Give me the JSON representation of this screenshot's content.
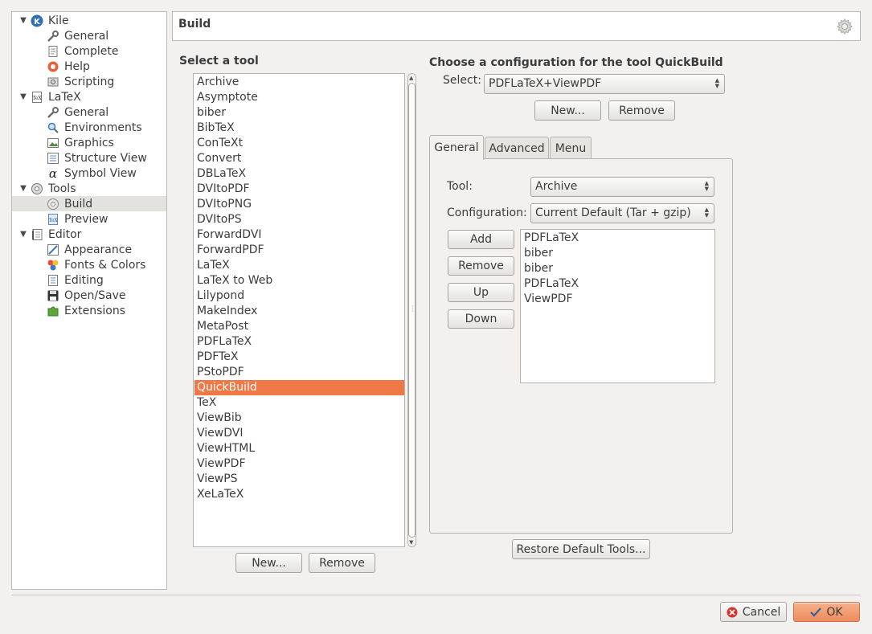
{
  "header": {
    "title": "Build"
  },
  "tree": [
    {
      "label": "Kile",
      "icon": "kile-icon",
      "level": 0,
      "expanded": true
    },
    {
      "label": "General",
      "icon": "wrench-icon",
      "level": 1
    },
    {
      "label": "Complete",
      "icon": "document-icon",
      "level": 1
    },
    {
      "label": "Help",
      "icon": "help-lifebuoy-icon",
      "level": 1
    },
    {
      "label": "Scripting",
      "icon": "scripting-gear-icon",
      "level": 1
    },
    {
      "label": "LaTeX",
      "icon": "tex-document-icon",
      "level": 0,
      "expanded": true
    },
    {
      "label": "General",
      "icon": "wrench-icon",
      "level": 1
    },
    {
      "label": "Environments",
      "icon": "magnifier-icon",
      "level": 1
    },
    {
      "label": "Graphics",
      "icon": "graphics-icon",
      "level": 1
    },
    {
      "label": "Structure View",
      "icon": "structure-view-icon",
      "level": 1
    },
    {
      "label": "Symbol View",
      "icon": "alpha-symbol-icon",
      "level": 1
    },
    {
      "label": "Tools",
      "icon": "tools-gear-icon",
      "level": 0,
      "expanded": true
    },
    {
      "label": "Build",
      "icon": "build-gear-icon",
      "level": 1,
      "selected": true
    },
    {
      "label": "Preview",
      "icon": "tex-preview-icon",
      "level": 1
    },
    {
      "label": "Editor",
      "icon": "editor-notebook-icon",
      "level": 0,
      "expanded": true
    },
    {
      "label": "Appearance",
      "icon": "appearance-icon",
      "level": 1
    },
    {
      "label": "Fonts & Colors",
      "icon": "fonts-colors-icon",
      "level": 1
    },
    {
      "label": "Editing",
      "icon": "editing-icon",
      "level": 1
    },
    {
      "label": "Open/Save",
      "icon": "floppy-disk-icon",
      "level": 1
    },
    {
      "label": "Extensions",
      "icon": "puzzle-piece-icon",
      "level": 1
    }
  ],
  "tools": {
    "title": "Select a tool",
    "items": [
      "Archive",
      "Asymptote",
      "biber",
      "BibTeX",
      "ConTeXt",
      "Convert",
      "DBLaTeX",
      "DVItoPDF",
      "DVItoPNG",
      "DVItoPS",
      "ForwardDVI",
      "ForwardPDF",
      "LaTeX",
      "LaTeX to Web",
      "Lilypond",
      "MakeIndex",
      "MetaPost",
      "PDFLaTeX",
      "PDFTeX",
      "PStoPDF",
      "QuickBuild",
      "TeX",
      "ViewBib",
      "ViewDVI",
      "ViewHTML",
      "ViewPDF",
      "ViewPS",
      "XeLaTeX"
    ],
    "selected": "QuickBuild",
    "new_label": "New...",
    "remove_label": "Remove"
  },
  "config": {
    "title": "Choose a configuration for the tool QuickBuild",
    "select_label": "Select:",
    "select_value": "PDFLaTeX+ViewPDF",
    "new_label": "New...",
    "remove_label": "Remove"
  },
  "tabs": [
    "General",
    "Advanced",
    "Menu"
  ],
  "active_tab": "General",
  "general": {
    "tool_label": "Tool:",
    "tool_value": "Archive",
    "configuration_label": "Configuration:",
    "configuration_value": "Current Default (Tar + gzip)",
    "add_label": "Add",
    "remove_label": "Remove",
    "up_label": "Up",
    "down_label": "Down",
    "items": [
      "PDFLaTeX",
      "biber",
      "biber",
      "PDFLaTeX",
      "ViewPDF"
    ]
  },
  "restore_label": "Restore Default Tools...",
  "footer": {
    "cancel_label": "Cancel",
    "ok_label": "OK"
  },
  "colors": {
    "selection": "#f07746",
    "ok_button": "#f3a27a",
    "background": "#f2f1f0"
  }
}
